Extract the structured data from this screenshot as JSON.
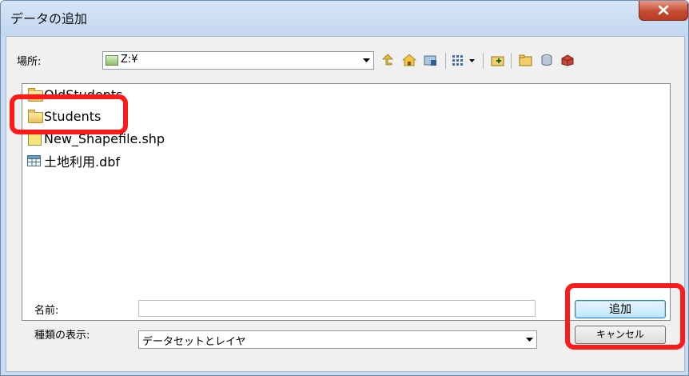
{
  "window": {
    "title": "データの追加"
  },
  "location": {
    "label": "場所:",
    "value": "Z:¥"
  },
  "files": [
    {
      "name": "OldStudents",
      "type": "folder"
    },
    {
      "name": "Students",
      "type": "folder"
    },
    {
      "name": "New_Shapefile.shp",
      "type": "shapefile"
    },
    {
      "name": "土地利用.dbf",
      "type": "table"
    }
  ],
  "name_field": {
    "label": "名前:",
    "value": ""
  },
  "filter": {
    "label": "種類の表示:",
    "value": "データセットとレイヤ"
  },
  "buttons": {
    "add": "追加",
    "cancel": "キャンセル"
  },
  "highlight_color": "#ff1a1a"
}
